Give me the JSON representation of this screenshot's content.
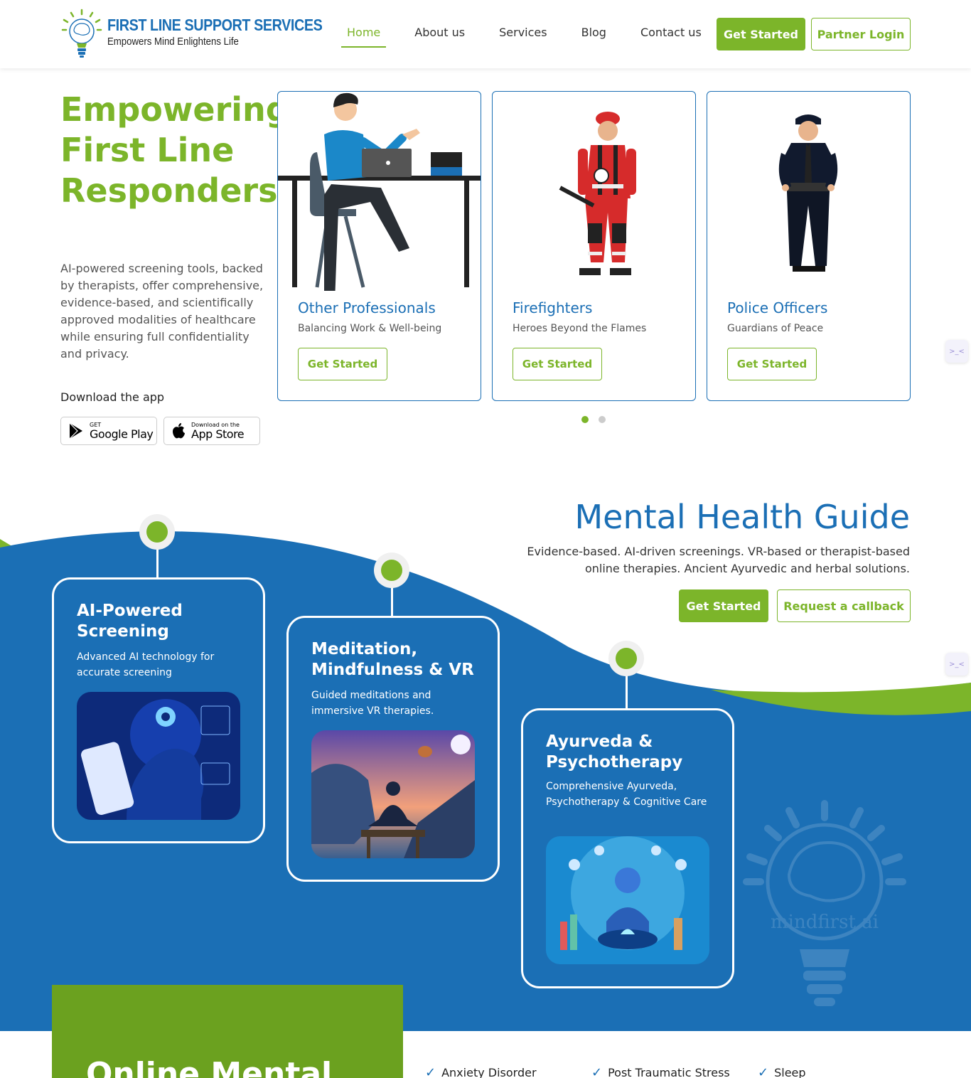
{
  "header": {
    "logo_title": "FIRST LINE SUPPORT SERVICES",
    "logo_tagline": "Empowers Mind Enlightens Life",
    "logo_brand": "mindfirst.ai",
    "nav": [
      "Home",
      "About us",
      "Services",
      "Blog",
      "Contact us"
    ],
    "active_nav": "Home",
    "get_started": "Get Started",
    "partner_login": "Partner Login"
  },
  "hero": {
    "title_lines": [
      "Empowering",
      "First Line",
      "Responders"
    ],
    "description": "AI-powered screening tools, backed by therapists, offer comprehensive, evidence-based, and scientifically approved modalities of healthcare while ensuring full confidentiality and privacy.",
    "download_label": "Download the app",
    "google_play_small": "GET",
    "google_play_big": "Google Play",
    "app_store_small": "Download on the",
    "app_store_big": "App Store"
  },
  "cards": [
    {
      "title": "Other Professionals",
      "subtitle": "Balancing Work & Well-being",
      "button": "Get Started"
    },
    {
      "title": "Firefighters",
      "subtitle": "Heroes Beyond the Flames",
      "button": "Get Started"
    },
    {
      "title": "Police Officers",
      "subtitle": "Guardians of Peace",
      "button": "Get Started"
    }
  ],
  "carousel": {
    "total": 2,
    "active": 1
  },
  "guide": {
    "title": "Mental Health Guide",
    "description": "Evidence-based. AI-driven screenings. VR-based or therapist-based online therapies. Ancient Ayurvedic and herbal solutions.",
    "get_started": "Get Started",
    "callback": "Request a callback"
  },
  "features": [
    {
      "title": "AI-Powered Screening",
      "desc": "Advanced AI technology for accurate screening"
    },
    {
      "title": "Meditation, Mindfulness & VR",
      "desc": "Guided meditations and immersive VR therapies."
    },
    {
      "title": "Ayurveda & Psychotherapy",
      "desc": "Comprehensive Ayurveda, Psychotherapy & Cognitive Care"
    }
  ],
  "watermark_text": "mindfirst.ai",
  "bottom": {
    "title": "Online Mental",
    "list": [
      "Anxiety Disorder",
      "Post Traumatic Stress",
      "Sleep"
    ]
  },
  "colors": {
    "green": "#7cb52a",
    "blue": "#1b6fb5"
  }
}
